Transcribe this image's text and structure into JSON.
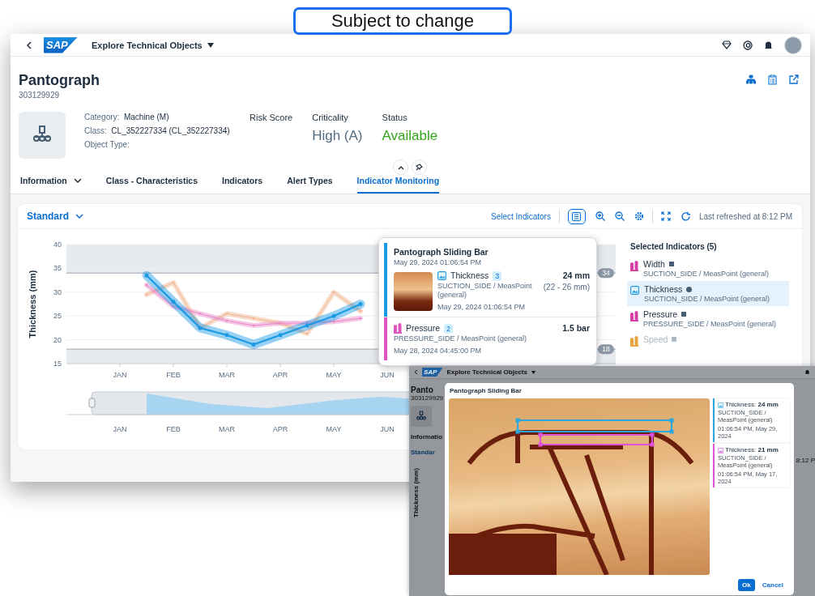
{
  "banner": {
    "text": "Subject to change"
  },
  "shell": {
    "logo": "SAP",
    "app_title": "Explore Technical Objects"
  },
  "object": {
    "title": "Pantograph",
    "id": "303129929",
    "fields": [
      {
        "label": "Category:",
        "value": "Machine (M)"
      },
      {
        "label": "Class:",
        "value": "CL_352227334 (CL_352227334)"
      },
      {
        "label": "Object Type:"
      }
    ],
    "kpis": [
      {
        "label": "Risk Score"
      },
      {
        "label": "Criticality",
        "value": "High (A)",
        "kind": "neutral"
      },
      {
        "label": "Status",
        "value": "Available",
        "kind": "positive"
      }
    ]
  },
  "tabs": [
    {
      "label": "Information",
      "selected": false,
      "menu": true
    },
    {
      "label": "Class - Characteristics",
      "selected": false,
      "menu": false
    },
    {
      "label": "Indicators",
      "selected": false,
      "menu": false
    },
    {
      "label": "Alert Types",
      "selected": false,
      "menu": false
    },
    {
      "label": "Indicator Monitoring",
      "selected": true,
      "menu": false
    }
  ],
  "toolbar": {
    "variant": "Standard",
    "select_indicators": "Select Indicators",
    "last_refreshed": "Last refreshed at 8:12 PM"
  },
  "chart": {
    "chart_data": {
      "type": "line",
      "ylabel": "Thickness (mm)",
      "categories": [
        "JAN",
        null,
        "FEB",
        null,
        "MAR",
        null,
        "APR",
        null,
        "MAY",
        null,
        "JUN"
      ],
      "series": [
        {
          "color": "#f2b48e",
          "values": [
            null,
            29.5,
            32,
            22.5,
            25.5,
            24.5,
            23.5,
            21.3,
            30,
            26,
            null
          ]
        },
        {
          "color": "#e887c8",
          "values": [
            null,
            31.5,
            27,
            25.5,
            24,
            23,
            23.5,
            23.5,
            23.8,
            24.5,
            null
          ]
        },
        {
          "color": "#1b9ae4",
          "values": [
            null,
            33.5,
            28,
            22.5,
            21,
            19,
            21,
            23,
            25,
            27.5,
            null
          ]
        }
      ],
      "ylim": [
        15,
        40
      ],
      "yticks": [
        15,
        20,
        25,
        30,
        35,
        40
      ],
      "grid": true,
      "ref_lines": [
        {
          "axis": "y",
          "value": 34,
          "label": "34"
        },
        {
          "axis": "y",
          "value": 18,
          "label": "18"
        }
      ],
      "bands": [
        {
          "axis": "y",
          "from": 34,
          "to": 40
        },
        {
          "axis": "y",
          "from": 15,
          "to": 18
        }
      ]
    },
    "navigator": {
      "labels": [
        "JAN",
        "FEB",
        "MAR",
        "APR",
        "MAY",
        "JUN"
      ]
    }
  },
  "selected_indicators": {
    "title": "Selected Indicators (5)",
    "items": [
      {
        "name": "Width",
        "detail": "SUCTION_SIDE / MeasPoint (general)",
        "marker": {
          "kind": "square"
        },
        "kind": "meter",
        "color": "#d63fa8",
        "selected": false,
        "disabled": false
      },
      {
        "name": "Thickness",
        "detail": "SUCTION_SIDE / MeasPoint (general)",
        "marker": {
          "kind": "circle"
        },
        "kind": "image",
        "color": "#1b9ae4",
        "selected": true,
        "disabled": false
      },
      {
        "name": "Pressure",
        "detail": "PRESSURE_SIDE / MeasPoint (general)",
        "marker": {
          "kind": "square"
        },
        "kind": "meter",
        "color": "#d63fa8",
        "selected": false,
        "disabled": false
      },
      {
        "name": "Speed",
        "marker": {
          "kind": "square"
        },
        "kind": "meter",
        "color": "#e8a33d",
        "selected": false,
        "disabled": true
      }
    ]
  },
  "tooltip": {
    "title": "Pantograph Sliding Bar",
    "timestamp": "May 29, 2024 01:06:54 PM",
    "entries": [
      {
        "kind": "image",
        "name": "Thickness",
        "count": "3",
        "detail": "SUCTION_SIDE / MeasPoint (general)",
        "timestamp": "May 29, 2024 01:06:54 PM",
        "value": "24 mm",
        "range": "(22 - 26 mm)",
        "color": "#1b9ae4"
      },
      {
        "kind": "meter",
        "name": "Pressure",
        "count": "2",
        "detail": "PRESSURE_SIDE / MeasPoint (general)",
        "timestamp": "May 28, 2024 04:45:00 PM",
        "value": "1.5 bar",
        "color": "#e056c0"
      }
    ]
  },
  "overlay_window": {
    "logo": "SAP",
    "app_title": "Explore Technical Objects",
    "page_title": "Panto",
    "id": "303129929",
    "tab": "Informatio",
    "variant": "Standar",
    "ylabel": "Thickness (mm)",
    "refreshed": "8:12 P"
  },
  "dialog": {
    "title": "Pantograph Sliding Bar",
    "markings": [
      {
        "text": "Thickness: **24 mm**",
        "detail": "SUCTION_SIDE / MeasPoint (general)",
        "timestamp": "01:06:54 PM, May 29, 2024",
        "color": "#29a8e0"
      },
      {
        "text": "Thickness: **21 mm**",
        "detail": "SUCTION_SIDE / MeasPoint (general)",
        "timestamp": "01:06:54 PM, May 17, 2024",
        "color": "#e050d8"
      }
    ],
    "buttons": [
      {
        "label": "Ok",
        "kind": "emphasized"
      },
      {
        "label": "Cancel",
        "kind": "transparent"
      }
    ]
  }
}
